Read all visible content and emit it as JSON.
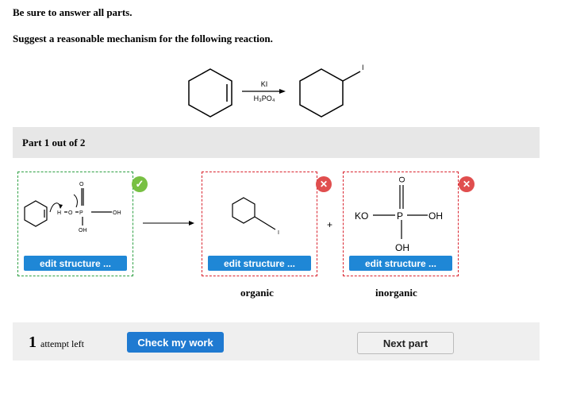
{
  "instructions": {
    "line1": "Be sure to answer all parts.",
    "line2": "Suggest a reasonable mechanism for the following reaction."
  },
  "reaction": {
    "reagent_top": "KI",
    "reagent_bottom": "H₃PO₄",
    "product_atom": "I"
  },
  "part": {
    "label": "Part 1 out of 2"
  },
  "mechanism": {
    "box1": {
      "button": "edit structure ...",
      "status": "correct",
      "atoms": {
        "h": "H",
        "o_bridge": "O",
        "p": "P",
        "o_top": "O",
        "oh_right": "OH",
        "oh_bottom": "OH"
      }
    },
    "box2": {
      "button": "edit structure ...",
      "status": "incorrect",
      "caption": "organic",
      "atoms": {
        "i": "I"
      }
    },
    "plus": "+",
    "box3": {
      "button": "edit structure ...",
      "status": "incorrect",
      "caption": "inorganic",
      "atoms": {
        "ko": "KO",
        "p": "P",
        "o_top": "O",
        "oh_right": "OH",
        "oh_bottom": "OH"
      }
    },
    "badges": {
      "correct_symbol": "✓",
      "incorrect_symbol": "✕"
    }
  },
  "footer": {
    "attempts_number": "1",
    "attempts_text": "attempt left",
    "check_button": "Check my work",
    "next_button": "Next part"
  },
  "colors": {
    "accent_blue": "#1f87d6",
    "correct_green": "#78c043",
    "error_red": "#e04e4e"
  }
}
